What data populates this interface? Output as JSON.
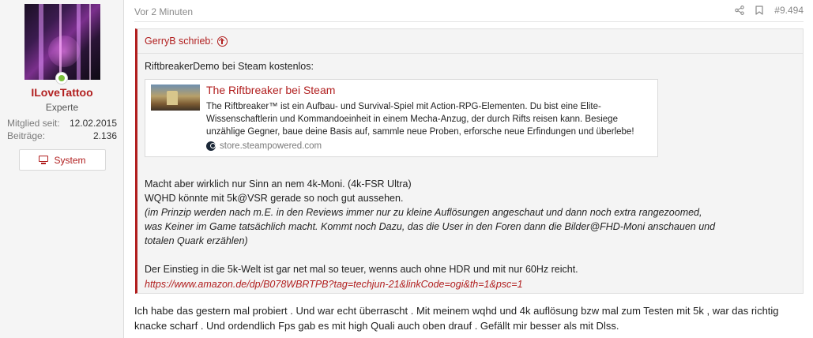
{
  "author": {
    "name": "ILoveTattoo",
    "title": "Experte",
    "stats": [
      {
        "label": "Mitglied seit:",
        "value": "12.02.2015"
      },
      {
        "label": "Beiträge:",
        "value": "2.136"
      }
    ],
    "system_button": "System"
  },
  "post": {
    "time": "Vor 2 Minuten",
    "number": "#9.494",
    "quote": {
      "author_line": "GerryB schrieb:",
      "intro": "RiftbreakerDemo bei Steam kostenlos:",
      "embed": {
        "title": "The Riftbreaker bei Steam",
        "description": "The Riftbreaker™ ist ein Aufbau- und Survival-Spiel mit Action-RPG-Elementen. Du bist eine Elite-Wissenschaftlerin und Kommandoeinheit in einem Mecha-Anzug, der durch Rifts reisen kann. Besiege unzählige Gegner, baue deine Basis auf, sammle neue Proben, erforsche neue Erfindungen und überlebe!",
        "source": "store.steampowered.com"
      },
      "line1": "Macht aber wirklich nur Sinn an nem 4k-Moni. (4k-FSR Ultra)",
      "line2": "WQHD könnte mit 5k@VSR gerade so noch gut aussehen.",
      "italic1": "(im Prinzip werden nach m.E. in den Reviews immer nur zu kleine Auflösungen angeschaut und dann noch extra rangezoomed,",
      "italic2": "was Keiner im Game tatsächlich macht. Kommt noch Dazu, das die User in den Foren dann die Bilder@FHD-Moni anschauen und",
      "italic3": "totalen Quark erzählen)",
      "line3": "Der Einstieg in die 5k-Welt ist gar net mal so teuer, wenns auch ohne HDR und mit nur 60Hz reicht.",
      "link": "https://www.amazon.de/dp/B078WBRTPB?tag=techjun-21&linkCode=ogi&th=1&psc=1"
    },
    "reply": "Ich habe das gestern mal probiert . Und war echt überrascht . Mit meinem wqhd und 4k auflösung bzw mal zum Testen mit 5k , war das richtig knacke scharf . Und ordendlich Fps gab es mit high Quali auch oben drauf . Gefällt mir besser als mit Dlss."
  },
  "colors": {
    "accent": "#b11f1f",
    "online": "#7bbf3a",
    "sidebar_bg": "#f5f5f5",
    "quote_bg": "#f4f4f4"
  },
  "icons": {
    "share": "share-icon",
    "bookmark": "bookmark-icon",
    "quote_jump": "arrow-up-circle-icon",
    "system": "monitor-icon",
    "source": "steam-icon"
  }
}
